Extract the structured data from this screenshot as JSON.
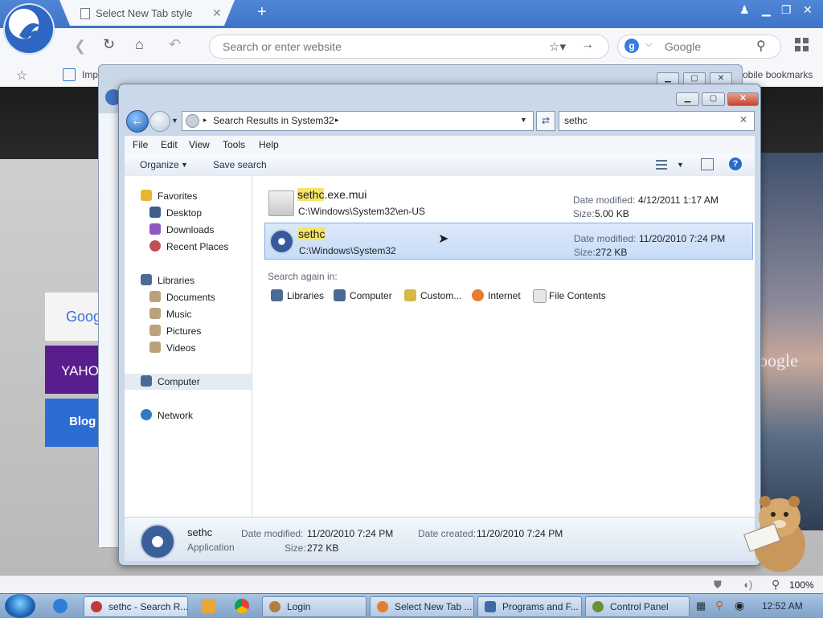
{
  "browser": {
    "tab_title": "Select New Tab style",
    "url_placeholder": "Search or enter website",
    "search_engine": "Google",
    "search_badge": "g",
    "bookmarks": {
      "import_label": "Imp",
      "mobile_label": "obile bookmarks"
    },
    "zoom": "100%"
  },
  "newtab": {
    "tiles": [
      "Googl",
      "YAHO",
      "Blog"
    ],
    "right_tile": "oogle"
  },
  "explorer": {
    "breadcrumb": "Search Results in System32",
    "search_value": "sethc",
    "menu": [
      "File",
      "Edit",
      "View",
      "Tools",
      "Help"
    ],
    "commands": {
      "organize": "Organize",
      "save_search": "Save search"
    },
    "nav": {
      "favorites": "Favorites",
      "desktop": "Desktop",
      "downloads": "Downloads",
      "recent": "Recent Places",
      "libraries": "Libraries",
      "documents": "Documents",
      "music": "Music",
      "pictures": "Pictures",
      "videos": "Videos",
      "computer": "Computer",
      "network": "Network"
    },
    "results": [
      {
        "name_hl": "sethc",
        "name_rest": ".exe.mui",
        "path": "C:\\Windows\\System32\\en-US",
        "date_label": "Date modified:",
        "date": "4/12/2011 1:17 AM",
        "size_label": "Size:",
        "size": "5.00 KB"
      },
      {
        "name_hl": "sethc",
        "name_rest": "",
        "path": "C:\\Windows\\System32",
        "date_label": "Date modified:",
        "date": "11/20/2010 7:24 PM",
        "size_label": "Size:",
        "size": "272 KB"
      }
    ],
    "search_again_label": "Search again in:",
    "search_again": [
      "Libraries",
      "Computer",
      "Custom...",
      "Internet",
      "File Contents"
    ],
    "details": {
      "name": "sethc",
      "type": "Application",
      "date_modified_label": "Date modified:",
      "date_modified": "11/20/2010 7:24 PM",
      "date_created_label": "Date created:",
      "date_created": "11/20/2010 7:24 PM",
      "size_label": "Size:",
      "size": "272 KB"
    }
  },
  "taskbar": {
    "items": [
      "sethc - Search R...",
      "Login",
      "Select New Tab ...",
      "Programs and F...",
      "Control Panel"
    ],
    "clock": "12:52 AM"
  },
  "colors": {
    "tabstrip": "#3f74c8",
    "highlight": "#f6e46a",
    "selection": "#c6dcf7",
    "close_button": "#c8432d"
  }
}
